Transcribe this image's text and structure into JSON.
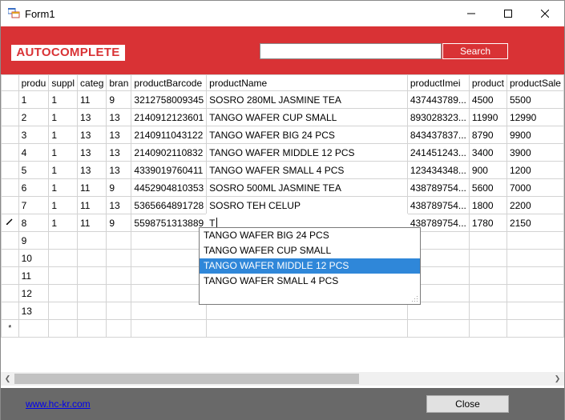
{
  "window": {
    "title": "Form1"
  },
  "header": {
    "logo": "AUTOCOMPLETE",
    "search_value": "",
    "search_button": "Search"
  },
  "grid": {
    "columns": [
      "productId",
      "supplierId",
      "categoryId",
      "brandId",
      "productBarcode",
      "productName",
      "productImei",
      "productBuyPrice",
      "productSalePrice"
    ],
    "column_display": [
      "produ",
      "suppl",
      "categ",
      "bran",
      "productBarcode",
      "productName",
      "productImei",
      "product",
      "productSale"
    ],
    "rows": [
      [
        "1",
        "1",
        "11",
        "9",
        "3212758009345",
        "SOSRO 280ML JASMINE TEA",
        "437443789...",
        "4500",
        "5500"
      ],
      [
        "2",
        "1",
        "13",
        "13",
        "2140912123601",
        "TANGO WAFER CUP SMALL",
        "893028323...",
        "11990",
        "12990"
      ],
      [
        "3",
        "1",
        "13",
        "13",
        "2140911043122",
        "TANGO WAFER BIG 24 PCS",
        "843437837...",
        "8790",
        "9900"
      ],
      [
        "4",
        "1",
        "13",
        "13",
        "2140902110832",
        "TANGO WAFER MIDDLE 12 PCS",
        "241451243...",
        "3400",
        "3900"
      ],
      [
        "5",
        "1",
        "13",
        "13",
        "4339019760411",
        "TANGO WAFER SMALL 4 PCS",
        "123434348...",
        "900",
        "1200"
      ],
      [
        "6",
        "1",
        "11",
        "9",
        "4452904810353",
        "SOSRO 500ML JASMINE TEA",
        "438789754...",
        "5600",
        "7000"
      ],
      [
        "7",
        "1",
        "11",
        "13",
        "5365664891728",
        "SOSRO TEH CELUP",
        "438789754...",
        "1800",
        "2200"
      ],
      [
        "8",
        "1",
        "11",
        "9",
        "5598751313889",
        "T",
        "438789754...",
        "1780",
        "2150"
      ],
      [
        "9",
        "",
        "",
        "",
        "",
        "",
        "",
        "",
        ""
      ],
      [
        "10",
        "",
        "",
        "",
        "",
        "",
        "",
        "",
        ""
      ],
      [
        "11",
        "",
        "",
        "",
        "",
        "",
        "",
        "",
        ""
      ],
      [
        "12",
        "",
        "",
        "",
        "",
        "",
        "",
        "",
        ""
      ],
      [
        "13",
        "",
        "",
        "",
        "",
        "",
        "",
        "",
        ""
      ],
      [
        "",
        "",
        "",
        "",
        "",
        "",
        "",
        "",
        ""
      ]
    ],
    "editing_row_marker": "pencil-icon",
    "new_row_marker": "*"
  },
  "autocomplete": {
    "items": [
      "TANGO WAFER BIG 24 PCS",
      "TANGO WAFER CUP SMALL",
      "TANGO WAFER MIDDLE 12 PCS",
      "TANGO WAFER SMALL 4 PCS"
    ],
    "selected_index": 2
  },
  "footer": {
    "link": "www.hc-kr.com",
    "close_button": "Close"
  },
  "colors": {
    "accent": "#d93235",
    "footer": "#696969",
    "selection": "#2f87d9",
    "link": "#0000ee"
  }
}
